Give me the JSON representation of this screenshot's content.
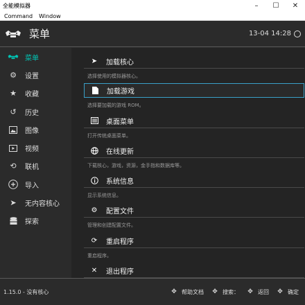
{
  "window": {
    "title": "全能模拟器",
    "menus": [
      "Command",
      "Window"
    ]
  },
  "header": {
    "title": "菜单",
    "clock": "13-04 14:28"
  },
  "sidebar": {
    "items": [
      {
        "label": "菜单",
        "icon": "retroarch-logo-icon",
        "active": true
      },
      {
        "label": "设置",
        "icon": "gear-icon"
      },
      {
        "label": "收藏",
        "icon": "star-icon"
      },
      {
        "label": "历史",
        "icon": "history-icon"
      },
      {
        "label": "图像",
        "icon": "image-icon"
      },
      {
        "label": "视频",
        "icon": "video-icon"
      },
      {
        "label": "联机",
        "icon": "netplay-icon"
      },
      {
        "label": "导入",
        "icon": "plus-icon"
      },
      {
        "label": "无内容核心",
        "icon": "rocket-icon"
      },
      {
        "label": "探索",
        "icon": "database-icon"
      }
    ]
  },
  "main": {
    "entries": [
      {
        "label": "加载核心",
        "desc": "选择使用的模拟器核心。",
        "icon": "rocket-icon"
      },
      {
        "label": "加载游戏",
        "desc": "选择要加载的游戏 ROM。",
        "icon": "file-icon",
        "selected": true
      },
      {
        "label": "桌面菜单",
        "desc": "打开传统桌面菜单。",
        "icon": "desktop-menu-icon"
      },
      {
        "label": "在线更新",
        "desc": "下载核心，游戏，资源，金手指和数据库等。",
        "icon": "globe-icon"
      },
      {
        "label": "系统信息",
        "desc": "显示系统信息。",
        "icon": "info-icon"
      },
      {
        "label": "配置文件",
        "desc": "管理和创建配置文件。",
        "icon": "config-icon"
      },
      {
        "label": "重启程序",
        "desc": "重启程序。",
        "icon": "restart-icon"
      },
      {
        "label": "退出程序",
        "desc": "",
        "icon": "close-icon"
      }
    ]
  },
  "footer": {
    "version": "1.15.0 - 没有核心",
    "hints": [
      {
        "label": "帮助文档",
        "icon": "dpad-help-icon"
      },
      {
        "label": "搜索：",
        "icon": "dpad-search-icon"
      },
      {
        "label": "返回",
        "icon": "dpad-back-icon"
      },
      {
        "label": "确定",
        "icon": "dpad-ok-icon"
      }
    ]
  },
  "colors": {
    "accent": "#00c4b4",
    "selection_border": "#3aa0c8",
    "background": "#2b2b2b",
    "list_background": "#242424"
  }
}
